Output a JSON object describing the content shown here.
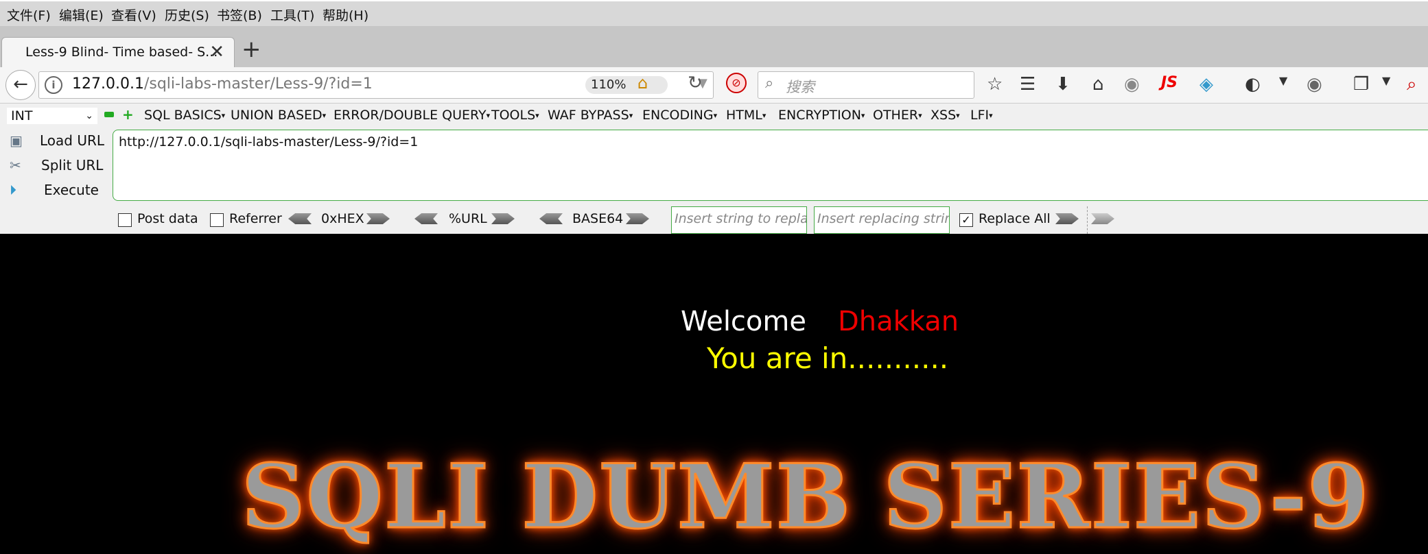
{
  "menubar": {
    "items": [
      "文件(F)",
      "编辑(E)",
      "查看(V)",
      "历史(S)",
      "书签(B)",
      "工具(T)",
      "帮助(H)"
    ]
  },
  "tab": {
    "title": "Less-9 Blind- Time based- S...",
    "close": "✕",
    "new_tab": "+"
  },
  "navbar": {
    "url_host": "127.0.0.1",
    "url_path": "/sqli-labs-master/Less-9/?id=1",
    "zoom": "110%",
    "search_placeholder": "搜索",
    "js_label": "JS"
  },
  "hackbar": {
    "type_select": "INT",
    "menus": [
      "SQL BASICS",
      "UNION BASED",
      "ERROR/DOUBLE QUERY",
      "TOOLS",
      "WAF BYPASS",
      "ENCODING",
      "HTML",
      "ENCRYPTION",
      "OTHER",
      "XSS",
      "LFI"
    ],
    "load_url": "Load URL",
    "split_url": "Split URL",
    "execute": "Execute",
    "url_value": "http://127.0.0.1/sqli-labs-master/Less-9/?id=1",
    "post_data": "Post data",
    "referrer": "Referrer",
    "hex": "0xHEX",
    "urlenc": "%URL",
    "base64": "BASE64",
    "replace_from_placeholder": "Insert string to replace",
    "replace_to_placeholder": "Insert replacing string",
    "replace_all": "Replace All",
    "post_data_checked": false,
    "referrer_checked": false,
    "replace_all_checked": true
  },
  "page": {
    "welcome": "Welcome",
    "name": "Dhakkan",
    "status": "You are in...........",
    "banner": "SQLI DUMB SERIES-9"
  },
  "colors": {
    "page_bg": "#000000",
    "name": "#ee0000",
    "status": "#ffff00",
    "banner_glow": "#ff5a00"
  }
}
